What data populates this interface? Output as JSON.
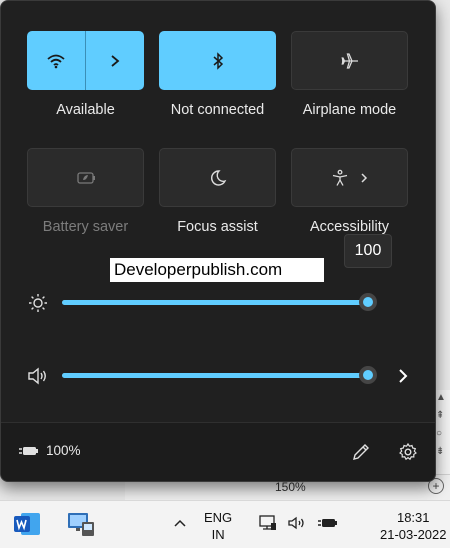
{
  "quick_settings": {
    "tiles": [
      {
        "label": "Available",
        "state": "on"
      },
      {
        "label": "Not connected",
        "state": "on"
      },
      {
        "label": "Airplane mode",
        "state": "off"
      },
      {
        "label": "Battery saver",
        "state": "disabled"
      },
      {
        "label": "Focus assist",
        "state": "off"
      },
      {
        "label": "Accessibility",
        "state": "off"
      }
    ],
    "brightness": {
      "value": 100,
      "tooltip": "100"
    },
    "volume": {
      "value": 100
    },
    "battery_text": "100%"
  },
  "overlay_text": "Developerpublish.com",
  "background_window": {
    "zoom_text": "150%"
  },
  "taskbar": {
    "language": {
      "line1": "ENG",
      "line2": "IN"
    },
    "clock": {
      "time": "18:31",
      "date": "21-03-2022"
    }
  },
  "colors": {
    "accent": "#60cdff",
    "panel": "#202020",
    "tile_off": "#2b2b2b"
  }
}
